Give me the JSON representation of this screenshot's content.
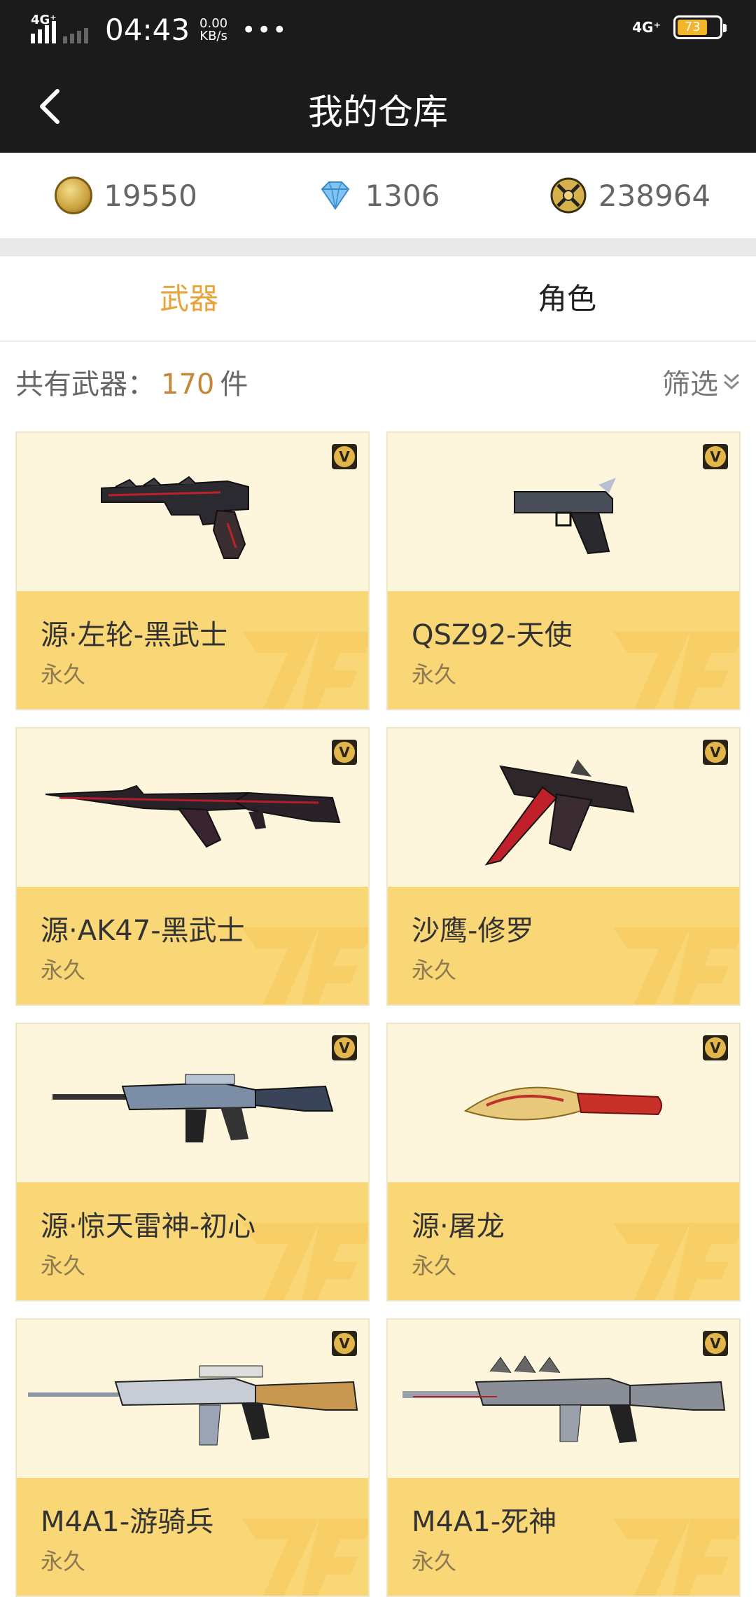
{
  "status_bar": {
    "network_left": "4G⁺",
    "time": "04:43",
    "speed_value": "0.00",
    "speed_unit": "KB/s",
    "dots": "•••",
    "network_right": "4G⁺",
    "battery": "73"
  },
  "header": {
    "title": "我的仓库"
  },
  "currency": {
    "coins": "19550",
    "diamonds": "1306",
    "points": "238964"
  },
  "tabs": [
    {
      "label": "武器",
      "active": true
    },
    {
      "label": "角色",
      "active": false
    }
  ],
  "summary": {
    "prefix": "共有武器：",
    "count": "170",
    "suffix": "件",
    "filter_label": "筛选"
  },
  "items": [
    {
      "name": "",
      "duration": "永久"
    },
    {
      "name": "",
      "duration": "永久"
    },
    {
      "name": "源·左轮-黑武士",
      "duration": "永久"
    },
    {
      "name": "QSZ92-天使",
      "duration": "永久"
    },
    {
      "name": "源·AK47-黑武士",
      "duration": "永久"
    },
    {
      "name": "沙鹰-修罗",
      "duration": "永久"
    },
    {
      "name": "源·惊天雷神-初心",
      "duration": "永久"
    },
    {
      "name": "源·屠龙",
      "duration": "永久"
    },
    {
      "name": "M4A1-游骑兵",
      "duration": "永久"
    },
    {
      "name": "M4A1-死神",
      "duration": "永久"
    }
  ],
  "colors": {
    "accent": "#e8a43a",
    "card_bg": "#fdf6dc",
    "card_footer": "#fad776",
    "header_bg": "#1b1b1b"
  }
}
